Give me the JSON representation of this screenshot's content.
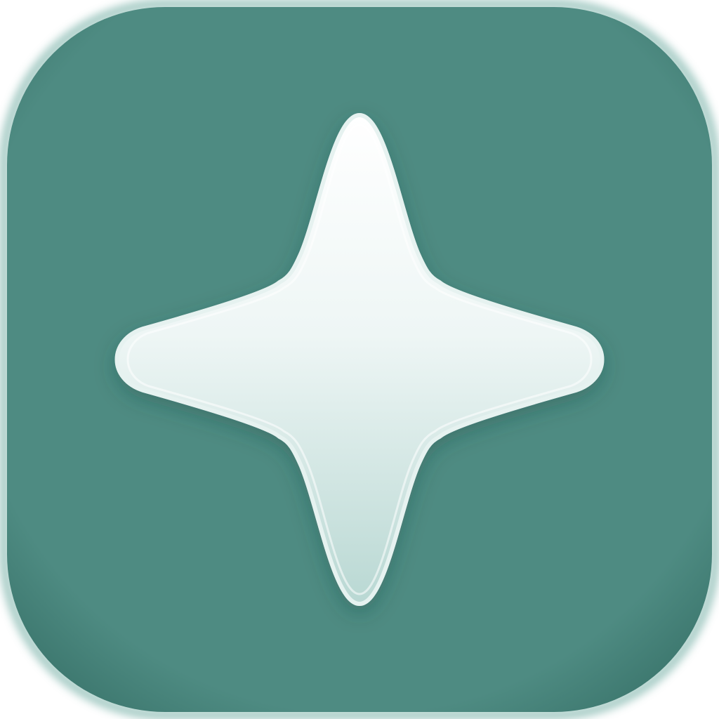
{
  "icon": {
    "name": "four-point-sparkle-star",
    "background_color": "#4E8B82",
    "background_edge_color": "#3F7A71",
    "rim_highlight_color": "#8DBDB5",
    "star_top_color": "#FFFFFF",
    "star_bottom_color": "#B9D8D3",
    "star_outline_color": "#E6F2F0"
  }
}
